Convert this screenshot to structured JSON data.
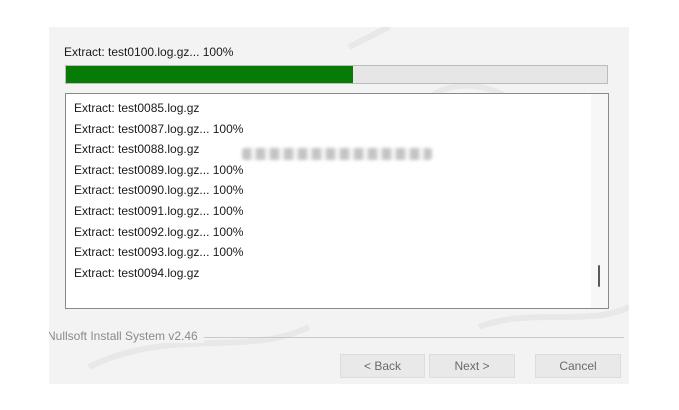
{
  "installer": {
    "status_text": "Extract: test0100.log.gz... 100%",
    "progress_fraction": 0.53,
    "progress_color": "#067b06",
    "log_lines": [
      "Extract: test0085.log.gz",
      "Extract: test0087.log.gz... 100%",
      "Extract: test0088.log.gz",
      "Extract: test0089.log.gz... 100%",
      "Extract: test0090.log.gz... 100%",
      "Extract: test0091.log.gz... 100%",
      "Extract: test0092.log.gz... 100%",
      "Extract: test0093.log.gz... 100%",
      "Extract: test0094.log.gz"
    ],
    "branding_text": "Nullsoft Install System v2.46",
    "buttons": {
      "back": "< Back",
      "next": "Next >",
      "cancel": "Cancel"
    },
    "watermark_text": "mlengineer"
  }
}
